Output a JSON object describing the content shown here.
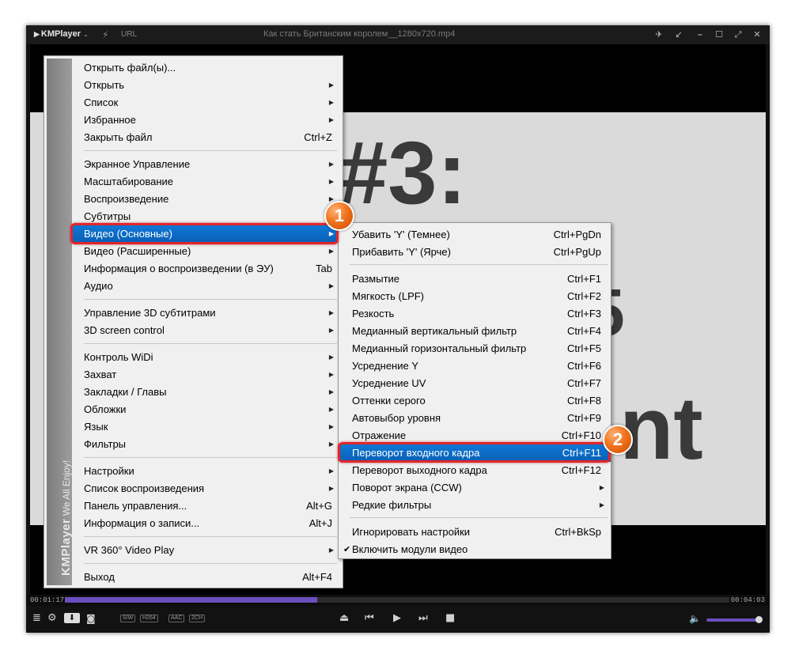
{
  "window": {
    "app_name": "KMPlayer",
    "url_label": "URL",
    "title": "Как стать Британским королем__1280x720.mp4",
    "buttons": [
      "pin-icon",
      "minimize-to-corner-icon",
      "minimize-icon",
      "maximize-icon",
      "fullscreen-icon",
      "close-icon"
    ]
  },
  "video": {
    "slide_text_1": "#3:",
    "slide_text_2": "5",
    "slide_text_3": "nt"
  },
  "seek": {
    "current_time": "00:01:17",
    "total_time": "00:04:03",
    "progress": 0.38
  },
  "controls": {
    "tags": [
      "S/W",
      "H264",
      "AAC",
      "2CH"
    ],
    "volume": 0.95
  },
  "main_menu": {
    "brand": "KMPlayer",
    "slogan": "We All Enjoy!",
    "items": [
      {
        "label": "Открыть файл(ы)...",
        "shortcut": "",
        "submenu": false
      },
      {
        "label": "Открыть",
        "shortcut": "",
        "submenu": true
      },
      {
        "label": "Список",
        "shortcut": "",
        "submenu": true
      },
      {
        "label": "Избранное",
        "shortcut": "",
        "submenu": true
      },
      {
        "label": "Закрыть файл",
        "shortcut": "Ctrl+Z",
        "submenu": false
      },
      {
        "label": "Экранное Управление",
        "shortcut": "",
        "submenu": true
      },
      {
        "label": "Масштабирование",
        "shortcut": "",
        "submenu": true
      },
      {
        "label": "Воспроизведение",
        "shortcut": "",
        "submenu": true
      },
      {
        "label": "Субтитры",
        "shortcut": "",
        "submenu": true
      },
      {
        "label": "Видео (Основные)",
        "shortcut": "",
        "submenu": true,
        "highlighted": true
      },
      {
        "label": "Видео (Расширенные)",
        "shortcut": "",
        "submenu": true
      },
      {
        "label": "Информация о воспроизведении (в ЭУ)",
        "shortcut": "Tab",
        "submenu": false
      },
      {
        "label": "Аудио",
        "shortcut": "",
        "submenu": true
      },
      {
        "label": "Управление 3D субтитрами",
        "shortcut": "",
        "submenu": true
      },
      {
        "label": "3D screen control",
        "shortcut": "",
        "submenu": true
      },
      {
        "label": "Контроль WiDi",
        "shortcut": "",
        "submenu": true
      },
      {
        "label": "Захват",
        "shortcut": "",
        "submenu": true
      },
      {
        "label": "Закладки / Главы",
        "shortcut": "",
        "submenu": true
      },
      {
        "label": "Обложки",
        "shortcut": "",
        "submenu": true
      },
      {
        "label": "Язык",
        "shortcut": "",
        "submenu": true
      },
      {
        "label": "Фильтры",
        "shortcut": "",
        "submenu": true
      },
      {
        "label": "Настройки",
        "shortcut": "",
        "submenu": true
      },
      {
        "label": "Список воспроизведения",
        "shortcut": "",
        "submenu": true
      },
      {
        "label": "Панель управления...",
        "shortcut": "Alt+G",
        "submenu": false
      },
      {
        "label": "Информация о записи...",
        "shortcut": "Alt+J",
        "submenu": false
      },
      {
        "label": "VR 360° Video Play",
        "shortcut": "",
        "submenu": true
      },
      {
        "label": "Выход",
        "shortcut": "Alt+F4",
        "submenu": false
      }
    ]
  },
  "video_submenu": {
    "items": [
      {
        "label": "Убавить 'Y' (Темнее)",
        "shortcut": "Ctrl+PgDn"
      },
      {
        "label": "Прибавить 'Y' (Ярче)",
        "shortcut": "Ctrl+PgUp"
      },
      {
        "label": "Размытие",
        "shortcut": "Ctrl+F1"
      },
      {
        "label": "Мягкость (LPF)",
        "shortcut": "Ctrl+F2"
      },
      {
        "label": "Резкость",
        "shortcut": "Ctrl+F3"
      },
      {
        "label": "Медианный вертикальный фильтр",
        "shortcut": "Ctrl+F4"
      },
      {
        "label": "Медианный горизонтальный фильтр",
        "shortcut": "Ctrl+F5"
      },
      {
        "label": "Усреднение  Y",
        "shortcut": "Ctrl+F6"
      },
      {
        "label": "Усреднение  UV",
        "shortcut": "Ctrl+F7"
      },
      {
        "label": "Оттенки серого",
        "shortcut": "Ctrl+F8"
      },
      {
        "label": "Автовыбор уровня",
        "shortcut": "Ctrl+F9"
      },
      {
        "label": "Отражение",
        "shortcut": "Ctrl+F10"
      },
      {
        "label": "Переворот входного кадра",
        "shortcut": "Ctrl+F11",
        "highlighted": true
      },
      {
        "label": "Переворот выходного кадра",
        "shortcut": "Ctrl+F12"
      },
      {
        "label": "Поворот экрана (CCW)",
        "shortcut": "",
        "submenu": true
      },
      {
        "label": "Редкие фильтры",
        "shortcut": "",
        "submenu": true
      },
      {
        "label": "Игнорировать настройки",
        "shortcut": "Ctrl+BkSp"
      },
      {
        "label": "Включить модули видео",
        "shortcut": "",
        "checked": true
      }
    ]
  },
  "annotations": {
    "badge_1": "1",
    "badge_2": "2",
    "highlight_color": "#e0262b",
    "badge_color": "#f0741d"
  }
}
